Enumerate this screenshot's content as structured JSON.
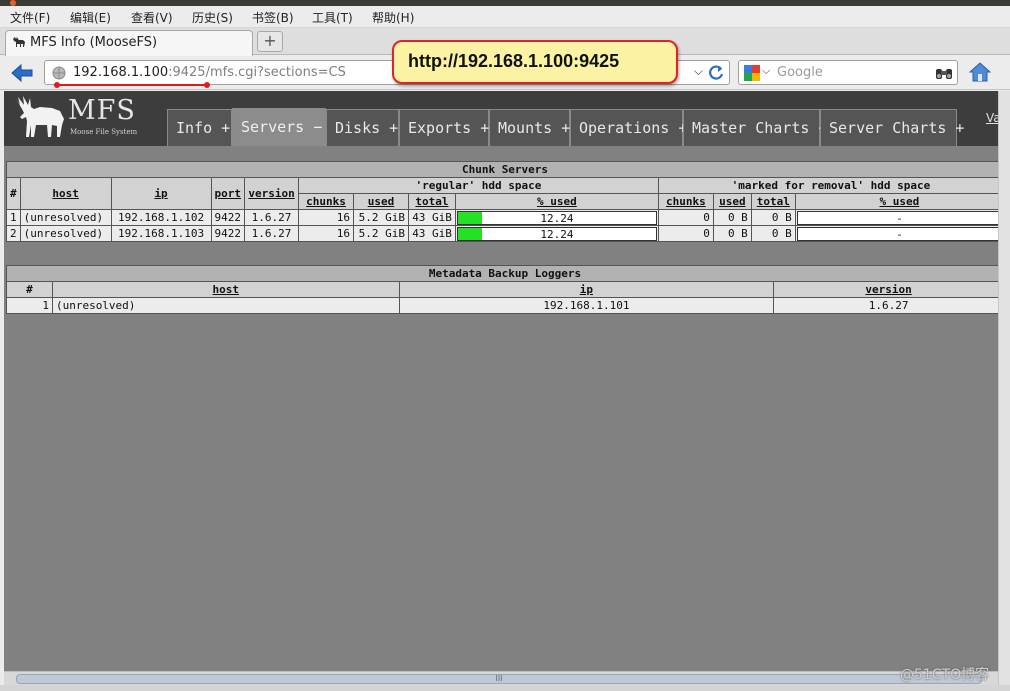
{
  "menu": [
    "文件(F)",
    "编辑(E)",
    "查看(V)",
    "历史(S)",
    "书签(B)",
    "工具(T)",
    "帮助(H)"
  ],
  "tab": {
    "title": "MFS Info (MooseFS)",
    "new_tab": "+"
  },
  "urlbar": {
    "host": "192.168.1.100",
    "path": ":9425/mfs.cgi?sections=CS"
  },
  "search": {
    "placeholder": "Google"
  },
  "callout": "http://192.168.1.100:9425",
  "logo": {
    "title": "MFS",
    "subtitle": "Moose File System"
  },
  "nav_tabs": [
    {
      "label": "Info +"
    },
    {
      "label": "Servers −"
    },
    {
      "label": "Disks +"
    },
    {
      "label": "Exports +"
    },
    {
      "label": "Mounts +"
    },
    {
      "label": "Operations +"
    },
    {
      "label": "Master Charts +"
    },
    {
      "label": "Server Charts +"
    }
  ],
  "nav_extra": "Va",
  "chunk_servers": {
    "caption": "Chunk Servers",
    "group_regular": "'regular' hdd space",
    "group_marked": "'marked for removal' hdd space",
    "headers": {
      "num": "#",
      "host": "host",
      "ip": "ip",
      "port": "port",
      "version": "version",
      "chunks": "chunks",
      "used": "used",
      "total": "total",
      "pct_used": "% used"
    },
    "rows": [
      {
        "num": "1",
        "host": "(unresolved)",
        "ip": "192.168.1.102",
        "port": "9422",
        "version": "1.6.27",
        "chunks": "16",
        "used": "5.2 GiB",
        "total": "43 GiB",
        "pct": "12.24",
        "pct_value": 12.24,
        "m_chunks": "0",
        "m_used": "0 B",
        "m_total": "0 B",
        "m_pct": "-"
      },
      {
        "num": "2",
        "host": "(unresolved)",
        "ip": "192.168.1.103",
        "port": "9422",
        "version": "1.6.27",
        "chunks": "16",
        "used": "5.2 GiB",
        "total": "43 GiB",
        "pct": "12.24",
        "pct_value": 12.24,
        "m_chunks": "0",
        "m_used": "0 B",
        "m_total": "0 B",
        "m_pct": "-"
      }
    ]
  },
  "metaloggers": {
    "caption": "Metadata Backup Loggers",
    "headers": {
      "num": "#",
      "host": "host",
      "ip": "ip",
      "version": "version"
    },
    "rows": [
      {
        "num": "1",
        "host": "(unresolved)",
        "ip": "192.168.1.101",
        "version": "1.6.27"
      }
    ]
  },
  "scroll_grip": "III",
  "watermark": "@51CTO博客",
  "colors": {
    "bar_fill": "#25e025",
    "callout_bg": "#fbf3a3",
    "callout_border": "#e0222b",
    "page_bg": "#818181"
  }
}
